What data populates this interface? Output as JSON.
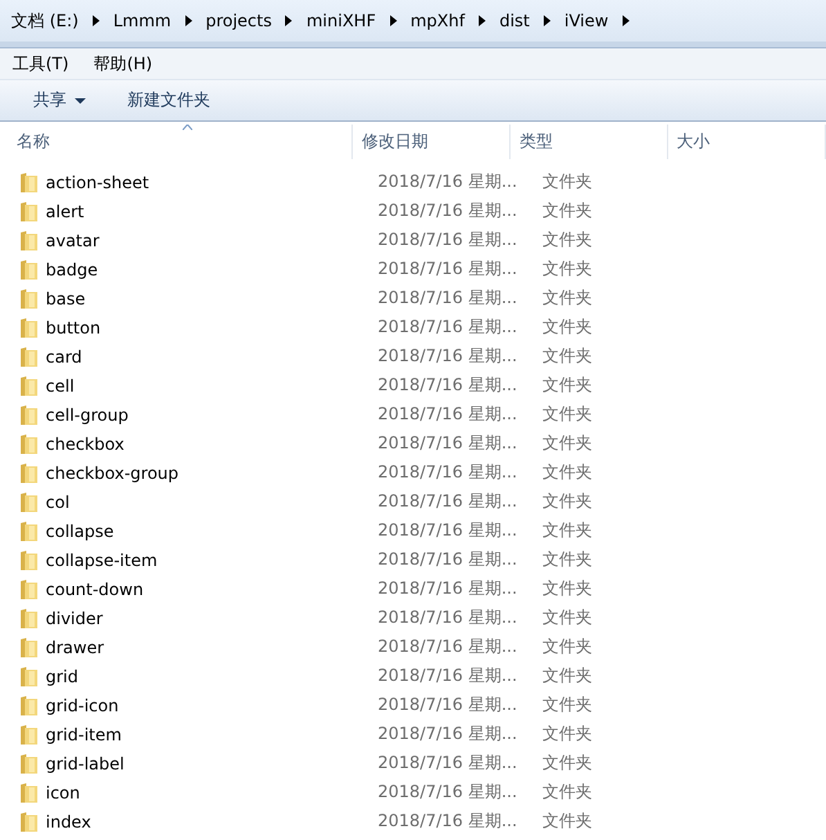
{
  "breadcrumb": [
    "文档 (E:)",
    "Lmmm",
    "projects",
    "miniXHF",
    "mpXhf",
    "dist",
    "iView"
  ],
  "menu": [
    "工具(T)",
    "帮助(H)"
  ],
  "toolbar": [
    {
      "label": "共享",
      "dropdown": true
    },
    {
      "label": "新建文件夹",
      "dropdown": false
    }
  ],
  "columns": [
    "名称",
    "修改日期",
    "类型",
    "大小"
  ],
  "rows": [
    {
      "name": "action-sheet",
      "date": "2018/7/16 星期...",
      "type": "文件夹"
    },
    {
      "name": "alert",
      "date": "2018/7/16 星期...",
      "type": "文件夹"
    },
    {
      "name": "avatar",
      "date": "2018/7/16 星期...",
      "type": "文件夹"
    },
    {
      "name": "badge",
      "date": "2018/7/16 星期...",
      "type": "文件夹"
    },
    {
      "name": "base",
      "date": "2018/7/16 星期...",
      "type": "文件夹"
    },
    {
      "name": "button",
      "date": "2018/7/16 星期...",
      "type": "文件夹"
    },
    {
      "name": "card",
      "date": "2018/7/16 星期...",
      "type": "文件夹"
    },
    {
      "name": "cell",
      "date": "2018/7/16 星期...",
      "type": "文件夹"
    },
    {
      "name": "cell-group",
      "date": "2018/7/16 星期...",
      "type": "文件夹"
    },
    {
      "name": "checkbox",
      "date": "2018/7/16 星期...",
      "type": "文件夹"
    },
    {
      "name": "checkbox-group",
      "date": "2018/7/16 星期...",
      "type": "文件夹"
    },
    {
      "name": "col",
      "date": "2018/7/16 星期...",
      "type": "文件夹"
    },
    {
      "name": "collapse",
      "date": "2018/7/16 星期...",
      "type": "文件夹"
    },
    {
      "name": "collapse-item",
      "date": "2018/7/16 星期...",
      "type": "文件夹"
    },
    {
      "name": "count-down",
      "date": "2018/7/16 星期...",
      "type": "文件夹"
    },
    {
      "name": "divider",
      "date": "2018/7/16 星期...",
      "type": "文件夹"
    },
    {
      "name": "drawer",
      "date": "2018/7/16 星期...",
      "type": "文件夹"
    },
    {
      "name": "grid",
      "date": "2018/7/16 星期...",
      "type": "文件夹"
    },
    {
      "name": "grid-icon",
      "date": "2018/7/16 星期...",
      "type": "文件夹"
    },
    {
      "name": "grid-item",
      "date": "2018/7/16 星期...",
      "type": "文件夹"
    },
    {
      "name": "grid-label",
      "date": "2018/7/16 星期...",
      "type": "文件夹"
    },
    {
      "name": "icon",
      "date": "2018/7/16 星期...",
      "type": "文件夹"
    },
    {
      "name": "index",
      "date": "2018/7/16 星期...",
      "type": "文件夹"
    }
  ]
}
